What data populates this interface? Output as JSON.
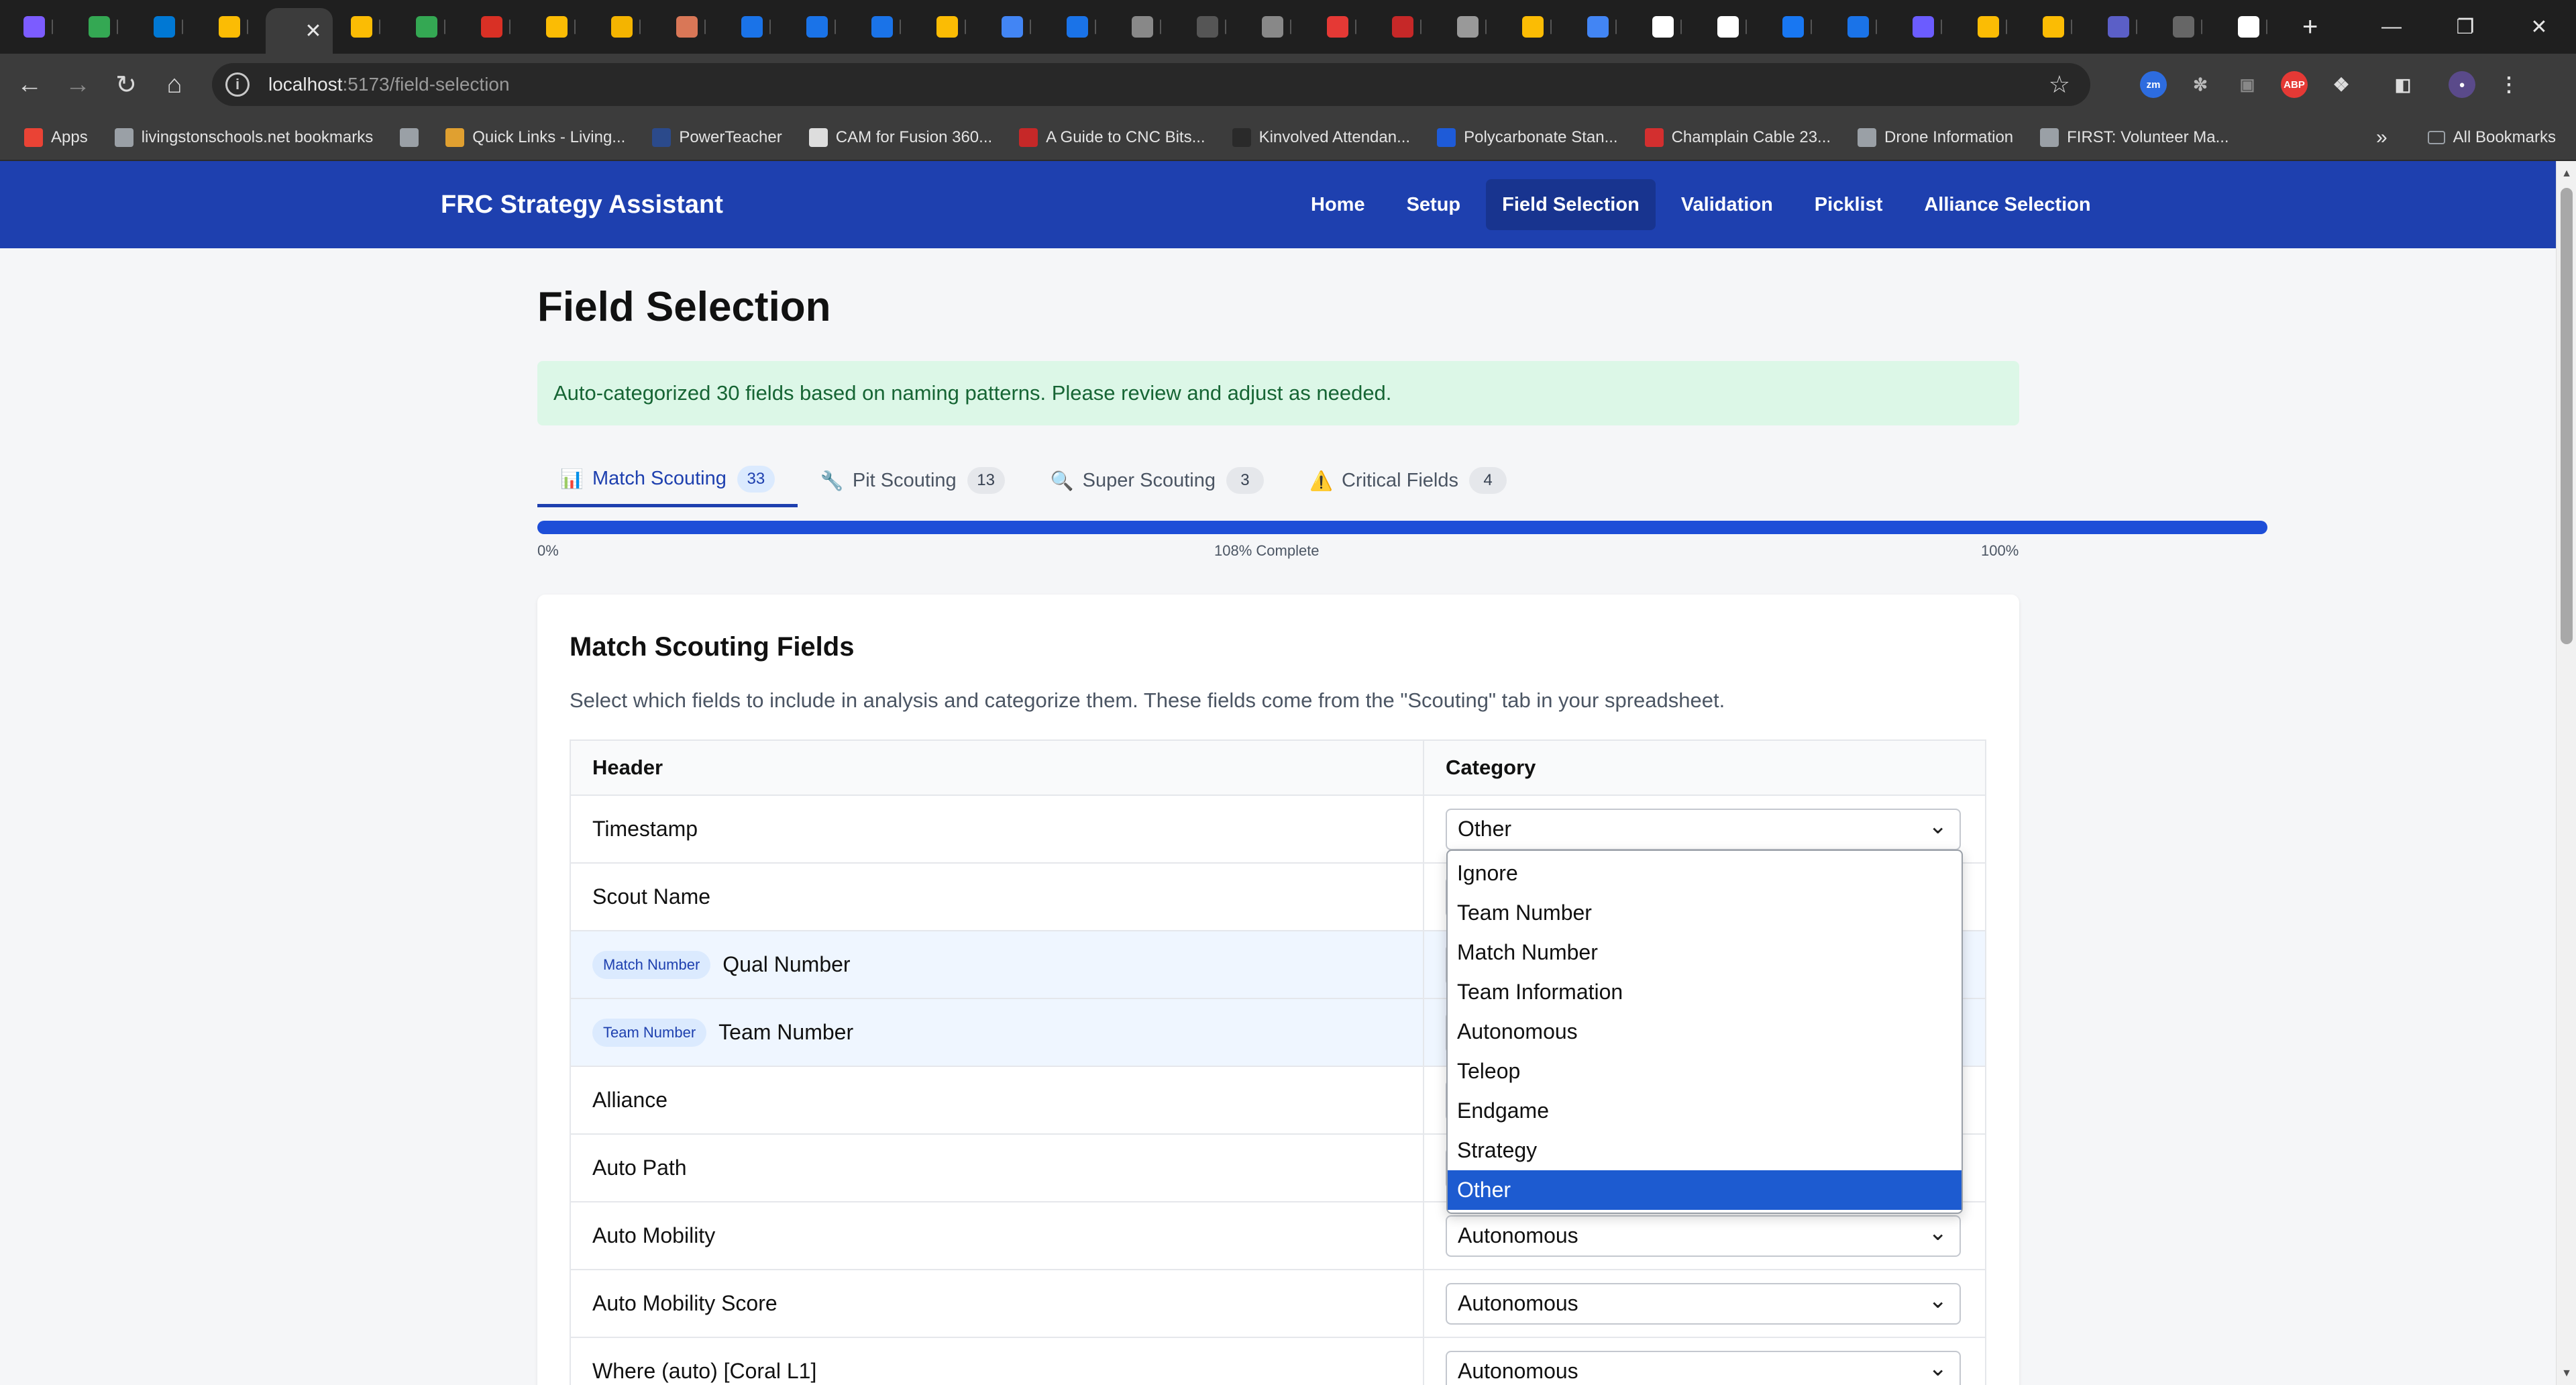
{
  "browser": {
    "tabs": [
      {
        "icon": "copilot-icon",
        "color": "#7c5cff"
      },
      {
        "icon": "sheets-icon",
        "color": "#34a853"
      },
      {
        "icon": "outlook-icon",
        "color": "#0078d4"
      },
      {
        "icon": "drive-icon",
        "color": "#fbbc04"
      },
      {
        "icon": "app-tab-icon",
        "color": "#3c3c3c",
        "active": true
      },
      {
        "icon": "drive-icon",
        "color": "#fbbc04"
      },
      {
        "icon": "sheets-plus-icon",
        "color": "#34a853"
      },
      {
        "icon": "docs-icon",
        "color": "#d93025"
      },
      {
        "icon": "drive-icon",
        "color": "#fbbc04"
      },
      {
        "icon": "slides-icon",
        "color": "#f4b400"
      },
      {
        "icon": "claude-icon",
        "color": "#d97757"
      },
      {
        "icon": "copilot-icon",
        "color": "#1a73e8"
      },
      {
        "icon": "copilot-icon",
        "color": "#1a73e8"
      },
      {
        "icon": "copilot-icon",
        "color": "#1a73e8"
      },
      {
        "icon": "drive-icon",
        "color": "#fbbc04"
      },
      {
        "icon": "docs-icon",
        "color": "#4285f4"
      },
      {
        "icon": "copilot-icon",
        "color": "#1a73e8"
      },
      {
        "icon": "github-icon",
        "color": "#888888"
      },
      {
        "icon": "blank-icon",
        "color": "#555555"
      },
      {
        "icon": "github-icon",
        "color": "#888888"
      },
      {
        "icon": "youtube-icon",
        "color": "#e53935"
      },
      {
        "icon": "robot-icon",
        "color": "#c62828"
      },
      {
        "icon": "openai-icon",
        "color": "#999999"
      },
      {
        "icon": "drive-icon",
        "color": "#fbbc04"
      },
      {
        "icon": "docs-icon",
        "color": "#4285f4"
      },
      {
        "icon": "google-icon",
        "color": "#ffffff"
      },
      {
        "icon": "chrome-icon",
        "color": "#ffffff"
      },
      {
        "icon": "facebook-icon",
        "color": "#1877f2"
      },
      {
        "icon": "copilot-icon",
        "color": "#1a73e8"
      },
      {
        "icon": "shield-icon",
        "color": "#6b5cff"
      },
      {
        "icon": "drive-icon",
        "color": "#fbbc04"
      },
      {
        "icon": "drive-icon",
        "color": "#fbbc04"
      },
      {
        "icon": "teams-icon",
        "color": "#5b5fc7"
      },
      {
        "icon": "github-icon",
        "color": "#666666"
      },
      {
        "icon": "download-icon",
        "color": "#ffffff"
      }
    ],
    "url_host": "localhost",
    "url_path": ":5173/field-selection",
    "bookmarks": [
      {
        "label": "Apps",
        "icon": "apps-grid-icon",
        "color": "#ea4335"
      },
      {
        "label": "livingstonschools.net bookmarks",
        "icon": "folder-icon",
        "color": "#9aa0a6"
      },
      {
        "label": "",
        "icon": "grid-icon",
        "color": "#9aa0a6"
      },
      {
        "label": "Quick Links - Living...",
        "icon": "quicklinks-icon",
        "color": "#e0a030"
      },
      {
        "label": "PowerTeacher",
        "icon": "powerteacher-icon",
        "color": "#2b4a8b"
      },
      {
        "label": "CAM for Fusion 360...",
        "icon": "autodesk-icon",
        "color": "#dddddd"
      },
      {
        "label": "A Guide to CNC Bits...",
        "icon": "cnc-icon",
        "color": "#c62828"
      },
      {
        "label": "Kinvolved Attendan...",
        "icon": "kinvolved-icon",
        "color": "#2a2a2a"
      },
      {
        "label": "Polycarbonate Stan...",
        "icon": "polycarb-icon",
        "color": "#1e5bd8"
      },
      {
        "label": "Champlain Cable 23...",
        "icon": "champlain-icon",
        "color": "#d32f2f"
      },
      {
        "label": "Drone Information",
        "icon": "folder-icon",
        "color": "#9aa0a6"
      },
      {
        "label": "FIRST: Volunteer Ma...",
        "icon": "globe-icon",
        "color": "#9aa0a6"
      }
    ],
    "all_bookmarks_label": "All Bookmarks"
  },
  "app": {
    "brand": "FRC Strategy Assistant",
    "nav": [
      "Home",
      "Setup",
      "Field Selection",
      "Validation",
      "Picklist",
      "Alliance Selection"
    ],
    "active_nav": 2
  },
  "page": {
    "title": "Field Selection",
    "alert": "Auto-categorized 30 fields based on naming patterns. Please review and adjust as needed.",
    "tabs": [
      {
        "label": "Match Scouting",
        "count": "33",
        "icon": "bar-chart-icon",
        "glyph": "📊"
      },
      {
        "label": "Pit Scouting",
        "count": "13",
        "icon": "wrench-icon",
        "glyph": "🔧"
      },
      {
        "label": "Super Scouting",
        "count": "3",
        "icon": "magnifier-icon",
        "glyph": "🔍"
      },
      {
        "label": "Critical Fields",
        "count": "4",
        "icon": "warning-icon",
        "glyph": "⚠️"
      }
    ],
    "progress": {
      "percent": 108,
      "start_label": "0%",
      "center_label": "108% Complete",
      "end_label": "100%"
    },
    "card": {
      "title": "Match Scouting Fields",
      "description": "Select which fields to include in analysis and categorize them. These fields come from the \"Scouting\" tab in your spreadsheet.",
      "header_col": "Header",
      "category_col": "Category",
      "rows": [
        {
          "header": "Timestamp",
          "tag": "",
          "category": "Other"
        },
        {
          "header": "Scout Name",
          "tag": "",
          "category": ""
        },
        {
          "header": "Qual Number",
          "tag": "Match Number",
          "category": ""
        },
        {
          "header": "Team Number",
          "tag": "Team Number",
          "category": ""
        },
        {
          "header": "Alliance",
          "tag": "",
          "category": ""
        },
        {
          "header": "Auto Path",
          "tag": "",
          "category": ""
        },
        {
          "header": "Auto Mobility",
          "tag": "",
          "category": "Autonomous"
        },
        {
          "header": "Auto Mobility Score",
          "tag": "",
          "category": "Autonomous"
        },
        {
          "header": "Where (auto) [Coral L1]",
          "tag": "",
          "category": "Autonomous"
        }
      ]
    },
    "dropdown": {
      "options": [
        "Ignore",
        "Team Number",
        "Match Number",
        "Team Information",
        "Autonomous",
        "Teleop",
        "Endgame",
        "Strategy",
        "Other"
      ],
      "selected": "Other"
    }
  }
}
